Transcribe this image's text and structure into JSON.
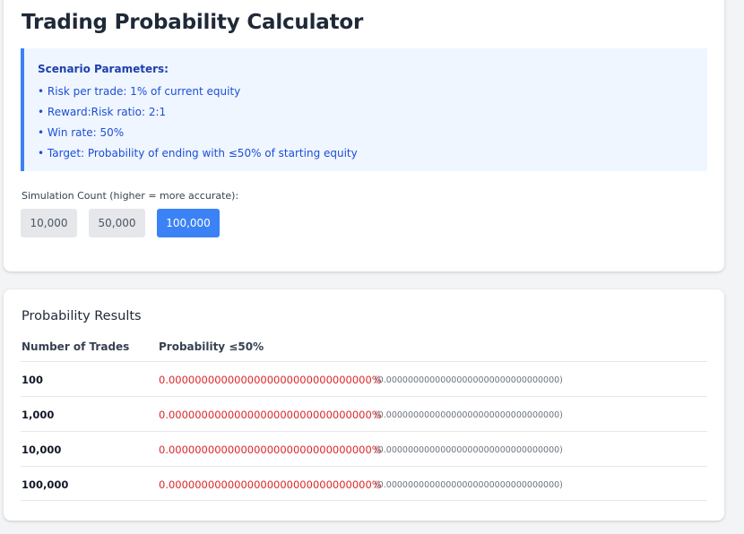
{
  "header": {
    "title": "Trading Probability Calculator"
  },
  "scenario": {
    "title": "Scenario Parameters:",
    "items": [
      "• Risk per trade: 1% of current equity",
      "• Reward:Risk ratio: 2:1",
      "• Win rate: 50%",
      "• Target: Probability of ending with ≤50% of starting equity"
    ]
  },
  "simulation": {
    "label": "Simulation Count (higher = more accurate):",
    "options": [
      "10,000",
      "50,000",
      "100,000"
    ],
    "selected": "100,000"
  },
  "results": {
    "title": "Probability Results",
    "columns": [
      "Number of Trades",
      "Probability ≤50%"
    ],
    "rows": [
      {
        "trades": "100",
        "probability": "0.0000000000000000000000000000000%",
        "raw": "(0.00000000000000000000000000000000)"
      },
      {
        "trades": "1,000",
        "probability": "0.0000000000000000000000000000000%",
        "raw": "(0.00000000000000000000000000000000)"
      },
      {
        "trades": "10,000",
        "probability": "0.0000000000000000000000000000000%",
        "raw": "(0.00000000000000000000000000000000)"
      },
      {
        "trades": "100,000",
        "probability": "0.0000000000000000000000000000000%",
        "raw": "(0.00000000000000000000000000000000)"
      }
    ]
  },
  "colors": {
    "accent": "#3b82f6",
    "probability_text": "#dc2626",
    "scenario_bg": "#eff6ff",
    "scenario_text": "#1d4ed8"
  }
}
